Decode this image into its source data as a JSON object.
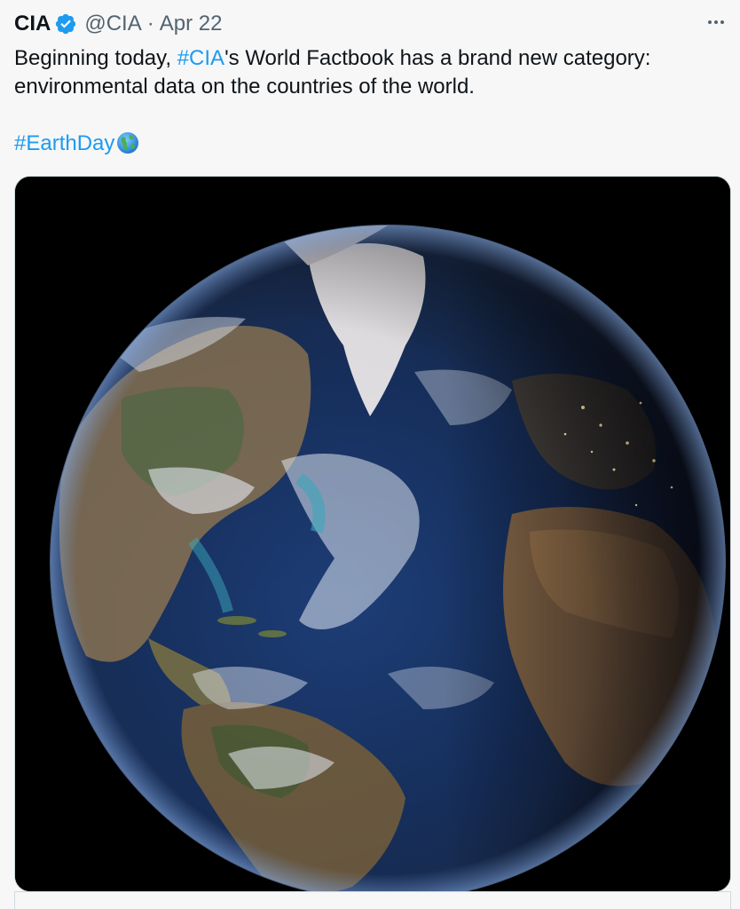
{
  "tweet": {
    "author_name": "CIA",
    "handle": "@CIA",
    "separator": "·",
    "date": "Apr 22",
    "text_before_link": "Beginning today, ",
    "mention_link": "#CIA",
    "text_after_link": "'s World Factbook has a brand new category:",
    "text_line2": "environmental data on the countries of the world.",
    "hashtag": "#EarthDay",
    "emoji": "globe-showing-americas-icon",
    "verified_icon": "verified-badge-icon",
    "more_icon": "more-options-icon"
  },
  "media": {
    "type": "photo",
    "icon": "earth-globe-photo"
  },
  "colors": {
    "link": "#1d9bf0",
    "text": "#0f1419",
    "secondary": "#536471",
    "background": "#f7f7f7",
    "photo_background": "#000000"
  }
}
